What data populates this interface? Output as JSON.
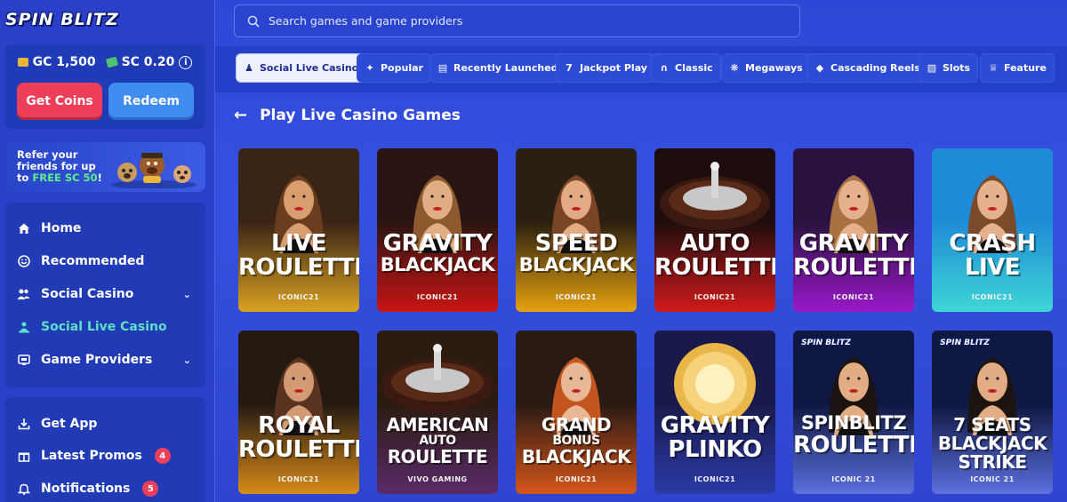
{
  "logo": {
    "text": "SPIN BLITZ"
  },
  "wallet": {
    "gc_label": "GC 1,500",
    "sc_label": "SC 0.20",
    "info_glyph": "i",
    "get_coins": "Get Coins",
    "redeem": "Redeem"
  },
  "refer": {
    "line1": "Refer your",
    "line2": "friends for up",
    "line3_pre": "to ",
    "line3_hl": "FREE SC 50",
    "line3_post": "!"
  },
  "nav": [
    {
      "label": "Home",
      "icon": "home-icon"
    },
    {
      "label": "Recommended",
      "icon": "smiley-icon"
    },
    {
      "label": "Social Casino",
      "icon": "people-icon"
    },
    {
      "label": "Social Live Casino",
      "icon": "live-dealer-icon"
    },
    {
      "label": "Game Providers",
      "icon": "providers-icon"
    }
  ],
  "nav2": [
    {
      "label": "Get App",
      "icon": "download-icon"
    },
    {
      "label": "Latest Promos",
      "icon": "gift-icon",
      "badge": "4"
    },
    {
      "label": "Notifications",
      "icon": "bell-icon",
      "badge": "5"
    }
  ],
  "search": {
    "placeholder": "Search games and game providers"
  },
  "tabs": [
    {
      "label": "Social Live Casino",
      "active": true
    },
    {
      "label": "Popular"
    },
    {
      "label": "Recently Launched"
    },
    {
      "label": "Jackpot Play"
    },
    {
      "label": "Classic"
    },
    {
      "label": "Megaways"
    },
    {
      "label": "Cascading Reels"
    },
    {
      "label": "Slots"
    },
    {
      "label": "Feature"
    }
  ],
  "heading": {
    "title": "Play Live Casino Games"
  },
  "games": [
    {
      "l1": "LIVE",
      "l2": "ROULETTE",
      "provider": "ICONIC21",
      "bg": [
        "#3a2416",
        "#d9a221"
      ],
      "skin": "#d89e70",
      "hair": "#6b3d1f"
    },
    {
      "l1": "GRAVITY",
      "l2": "BLACKJACK",
      "provider": "ICONIC21",
      "bg": [
        "#2a1512",
        "#c91414"
      ],
      "skin": "#e2ad84",
      "hair": "#8d5a2e"
    },
    {
      "l1": "SPEED",
      "l2": "BLACKJACK",
      "provider": "ICONIC21",
      "bg": [
        "#2a1f10",
        "#e6a20f"
      ],
      "skin": "#e3aa83",
      "hair": "#7a4526"
    },
    {
      "l1": "AUTO",
      "l2": "ROULETTE",
      "provider": "ICONIC21",
      "bg": [
        "#1f0d0d",
        "#d01a1a"
      ],
      "skin": "#000000",
      "hair": "#000000"
    },
    {
      "l1": "GRAVITY",
      "l2": "ROULETTE",
      "provider": "ICONIC21",
      "bg": [
        "#2a1240",
        "#9a18c9"
      ],
      "skin": "#e6b08c",
      "hair": "#a87142"
    },
    {
      "l1": "CRASH",
      "l2": "LIVE",
      "provider": "ICONIC21",
      "bg": [
        "#1f8bd6",
        "#3fd6d6"
      ],
      "skin": "#e6b08c",
      "hair": "#7a4a2a"
    },
    {
      "l1": "ROYAL",
      "l2": "ROULETTE",
      "provider": "ICONIC21",
      "bg": [
        "#241a12",
        "#d88b18"
      ],
      "skin": "#d39a74",
      "hair": "#5a3420"
    },
    {
      "l1": "AMERICAN",
      "l2": "AUTO",
      "l3": "ROULETTE",
      "provider": "VIVO GAMING",
      "bg": [
        "#2a1c10",
        "#5a2a6a"
      ],
      "skin": "#000000",
      "hair": "#000000"
    },
    {
      "l1": "GRAND",
      "l2": "BONUS",
      "l3": "BLACKJACK",
      "provider": "ICONIC21",
      "bg": [
        "#2a1a14",
        "#d6561a"
      ],
      "skin": "#e8b896",
      "hair": "#c2561e"
    },
    {
      "l1": "GRAVITY",
      "l2": "PLINKO",
      "provider": "ICONIC21",
      "bg": [
        "#1a1a4a",
        "#2a3aa8"
      ],
      "skin": "#000000",
      "hair": "#000000"
    },
    {
      "l1": "SPINBLITZ",
      "l2": "ROULETTE",
      "provider": "ICONIC 21",
      "bg": [
        "#0f1840",
        "#5b6fe0"
      ],
      "skin": "#e2ad84",
      "hair": "#1c1410",
      "brand": "SPIN BLITZ"
    },
    {
      "l1": "7 SEATS",
      "l2": "BLACKJACK",
      "l3": "STRIKE",
      "provider": "ICONIC 21",
      "bg": [
        "#0f1840",
        "#5b6fe0"
      ],
      "skin": "#e2ad84",
      "hair": "#1c1410",
      "brand": "SPIN BLITZ"
    }
  ]
}
